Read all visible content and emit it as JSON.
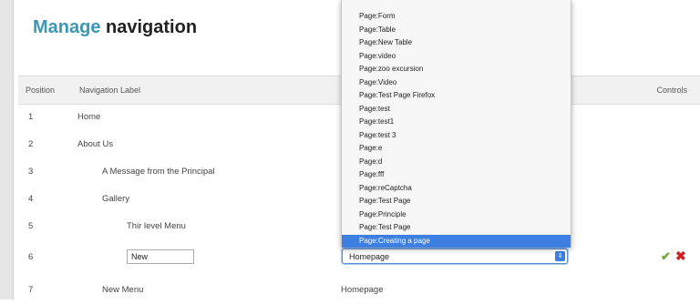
{
  "page": {
    "title_accent": "Manage",
    "title_rest": "navigation"
  },
  "table": {
    "headers": {
      "position": "Position",
      "label": "Navigation Label",
      "controls": "Controls"
    },
    "rows": [
      {
        "position": "1",
        "label": "Home",
        "page": ""
      },
      {
        "position": "2",
        "label": "About Us",
        "page": ""
      },
      {
        "position": "3",
        "label": "A Message from the Principal",
        "page": ""
      },
      {
        "position": "4",
        "label": "Gallery",
        "page": ""
      },
      {
        "position": "5",
        "label": "Thir level Menu",
        "page": ""
      },
      {
        "position": "6",
        "label": "New",
        "page": "Homepage"
      },
      {
        "position": "7",
        "label": "New Menu",
        "page": "Homepage"
      }
    ]
  },
  "dropdown": {
    "items": [
      "Page:Form",
      "Page:Table",
      "Page:New Table",
      "Page:video",
      "Page:zoo excursion",
      "Page:Video",
      "Page:Test Page Firefox",
      "Page:test",
      "Page:test1",
      "Page:test 3",
      "Page:e",
      "Page:d",
      "Page:fff",
      "Page:reCaptcha",
      "Page:Test Page",
      "Page:Principle",
      "Page:Test Page",
      "Page:Creating a page"
    ],
    "selected_index": 17
  },
  "colors": {
    "title_accent": "#3a98b7",
    "selection": "#3d7fe0",
    "save_icon": "#6aa63a",
    "cancel_icon": "#cc2222"
  },
  "icons": {
    "save": "checkmark-icon",
    "cancel": "close-icon",
    "select_arrow": "updown-arrows-icon"
  }
}
